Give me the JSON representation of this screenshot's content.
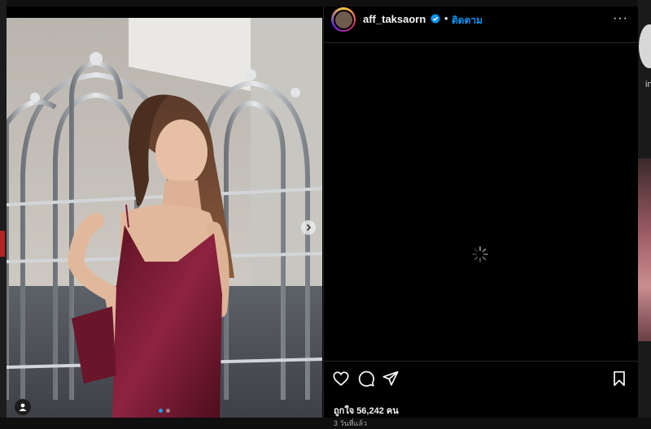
{
  "post": {
    "username": "aff_taksaorn",
    "separator": "•",
    "follow_label": "ติดตาม",
    "more_label": "···",
    "likes_text": "ถูกใจ 56,242 คน",
    "time_ago": "3 วันที่แล้ว",
    "carousel": {
      "slide_count": 2,
      "active_slide": 1
    }
  },
  "right_peek": {
    "text": "in"
  },
  "colors": {
    "accent": "#0095f6",
    "verified": "#0095f6",
    "background": "#000000",
    "dress": "#7a1c34"
  },
  "icons": [
    "verified-badge-icon",
    "more-options-icon",
    "heart-icon",
    "comment-icon",
    "share-icon",
    "bookmark-icon",
    "next-arrow-icon",
    "user-tag-icon",
    "loading-spinner-icon"
  ]
}
